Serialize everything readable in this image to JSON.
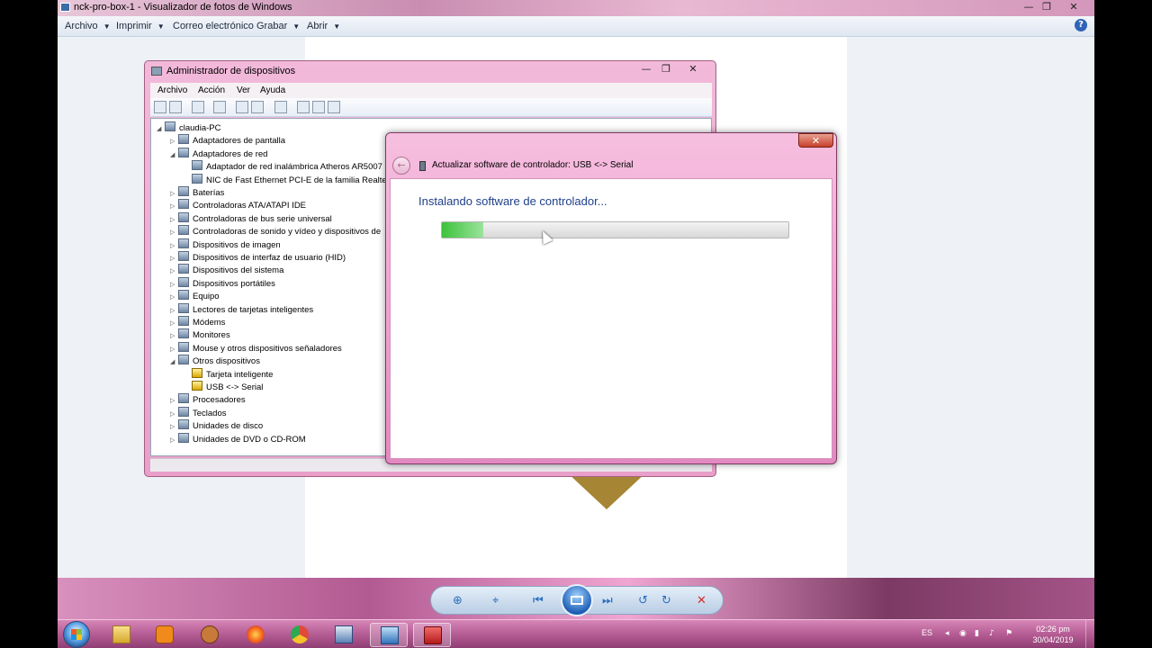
{
  "viewer": {
    "title": "nck-pro-box-1 - Visualizador de fotos de Windows",
    "menu": [
      {
        "label": "Archivo",
        "dropdown": true
      },
      {
        "label": "Imprimir",
        "dropdown": true
      },
      {
        "label": "Correo electrónico",
        "dropdown": false
      },
      {
        "label": "Grabar",
        "dropdown": true
      },
      {
        "label": "Abrir",
        "dropdown": true
      }
    ],
    "help_icon": "?"
  },
  "devmgr": {
    "title": "Administrador de dispositivos",
    "menu": [
      "Archivo",
      "Acción",
      "Ver",
      "Ayuda"
    ],
    "tree": [
      {
        "label": "claudia-PC",
        "level": 0,
        "expander": "◢"
      },
      {
        "label": "Adaptadores de pantalla",
        "level": 1,
        "expander": "▷"
      },
      {
        "label": "Adaptadores de red",
        "level": 1,
        "expander": "◢"
      },
      {
        "label": "Adaptador de red inalámbrica Atheros AR5007",
        "level": 2,
        "expander": ""
      },
      {
        "label": "NIC de Fast Ethernet PCI-E de la familia Realte",
        "level": 2,
        "expander": ""
      },
      {
        "label": "Baterías",
        "level": 1,
        "expander": "▷"
      },
      {
        "label": "Controladoras ATA/ATAPI IDE",
        "level": 1,
        "expander": "▷"
      },
      {
        "label": "Controladoras de bus serie universal",
        "level": 1,
        "expander": "▷"
      },
      {
        "label": "Controladoras de sonido y vídeo y dispositivos de",
        "level": 1,
        "expander": "▷"
      },
      {
        "label": "Dispositivos de imagen",
        "level": 1,
        "expander": "▷"
      },
      {
        "label": "Dispositivos de interfaz de usuario (HID)",
        "level": 1,
        "expander": "▷"
      },
      {
        "label": "Dispositivos del sistema",
        "level": 1,
        "expander": "▷"
      },
      {
        "label": "Dispositivos portátiles",
        "level": 1,
        "expander": "▷"
      },
      {
        "label": "Equipo",
        "level": 1,
        "expander": "▷"
      },
      {
        "label": "Lectores de tarjetas inteligentes",
        "level": 1,
        "expander": "▷"
      },
      {
        "label": "Módems",
        "level": 1,
        "expander": "▷"
      },
      {
        "label": "Monitores",
        "level": 1,
        "expander": "▷"
      },
      {
        "label": "Mouse y otros dispositivos señaladores",
        "level": 1,
        "expander": "▷"
      },
      {
        "label": "Otros dispositivos",
        "level": 1,
        "expander": "◢"
      },
      {
        "label": "Tarjeta inteligente",
        "level": 2,
        "expander": "",
        "warning": true
      },
      {
        "label": "USB <-> Serial",
        "level": 2,
        "expander": "",
        "warning": true
      },
      {
        "label": "Procesadores",
        "level": 1,
        "expander": "▷"
      },
      {
        "label": "Teclados",
        "level": 1,
        "expander": "▷"
      },
      {
        "label": "Unidades de disco",
        "level": 1,
        "expander": "▷"
      },
      {
        "label": "Unidades de DVD o CD-ROM",
        "level": 1,
        "expander": "▷"
      }
    ]
  },
  "dialog": {
    "title": "Actualizar software de controlador: USB <-> Serial",
    "heading": "Instalando software de controlador...",
    "progress": 0.12,
    "close_glyph": "✕"
  },
  "taskbar": {
    "apps": [
      "windows-explorer",
      "media-player",
      "gimp",
      "firefox",
      "chrome",
      "network-tool",
      "photo-viewer",
      "toolbox-app"
    ],
    "language": "ES",
    "time": "02:26 pm",
    "date": "30/04/2019"
  },
  "colors": {
    "accent_pink": "#e99fca",
    "heading_blue": "#1f3f8a",
    "progress_green": "#3cc23c"
  }
}
